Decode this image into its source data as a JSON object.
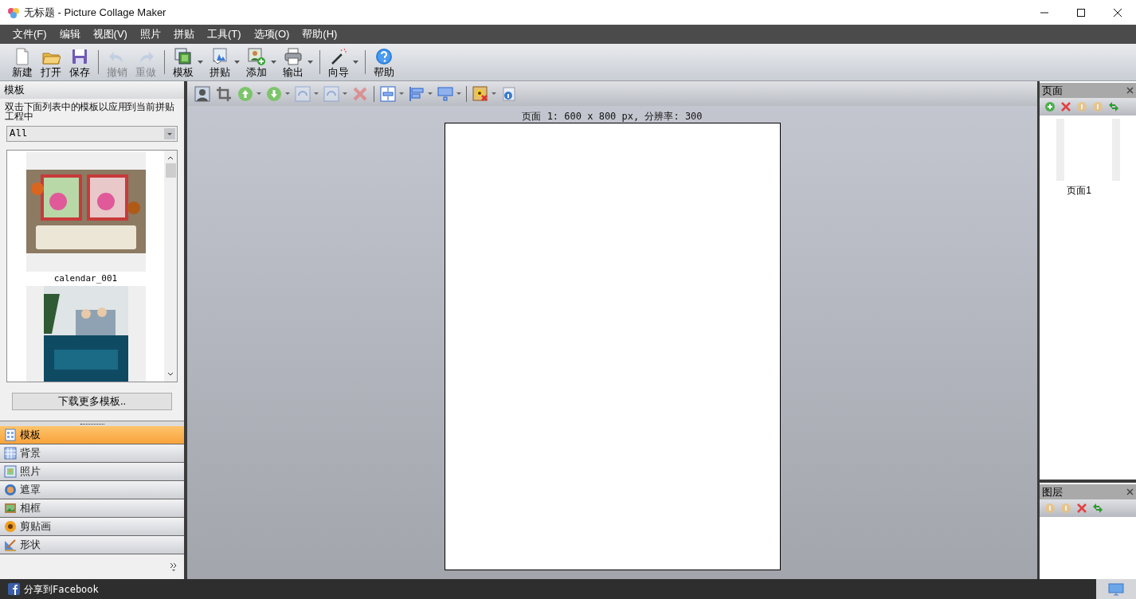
{
  "window": {
    "title": "无标题 - Picture Collage Maker"
  },
  "menu": [
    "文件(F)",
    "编辑",
    "视图(V)",
    "照片",
    "拼贴",
    "工具(T)",
    "选项(O)",
    "帮助(H)"
  ],
  "toolbar": [
    {
      "label": "新建",
      "disabled": false,
      "dropdown": false
    },
    {
      "label": "打开",
      "disabled": false,
      "dropdown": false
    },
    {
      "label": "保存",
      "disabled": false,
      "dropdown": false
    },
    {
      "label": "撤销",
      "disabled": true,
      "dropdown": false
    },
    {
      "label": "重做",
      "disabled": true,
      "dropdown": false
    },
    {
      "label": "模板",
      "disabled": false,
      "dropdown": true
    },
    {
      "label": "拼贴",
      "disabled": false,
      "dropdown": true
    },
    {
      "label": "添加",
      "disabled": false,
      "dropdown": true
    },
    {
      "label": "输出",
      "disabled": false,
      "dropdown": true
    },
    {
      "label": "向导",
      "disabled": false,
      "dropdown": true
    },
    {
      "label": "帮助",
      "disabled": false,
      "dropdown": false
    }
  ],
  "left_panel": {
    "title": "模板",
    "hint": "双击下面列表中的模板以应用到当前拼贴工程中",
    "filter": "All",
    "templates": [
      {
        "kind": "picture",
        "label": "calendar_001"
      },
      {
        "kind": "picture"
      }
    ],
    "download_button": "下载更多模板..",
    "nav": [
      {
        "label": "模板",
        "selected": true
      },
      {
        "label": "背景",
        "selected": false
      },
      {
        "label": "照片",
        "selected": false
      },
      {
        "label": "遮罩",
        "selected": false
      },
      {
        "label": "相框",
        "selected": false
      },
      {
        "label": "剪贴画",
        "selected": false
      },
      {
        "label": "形状",
        "selected": false
      }
    ]
  },
  "canvas": {
    "caption": "页面 1: 600 x 800 px, 分辨率: 300"
  },
  "pages_panel": {
    "title": "页面",
    "pages": [
      {
        "label": "页面1"
      }
    ]
  },
  "layers_panel": {
    "title": "图层"
  },
  "status_bar": {
    "share": "分享到Facebook"
  }
}
